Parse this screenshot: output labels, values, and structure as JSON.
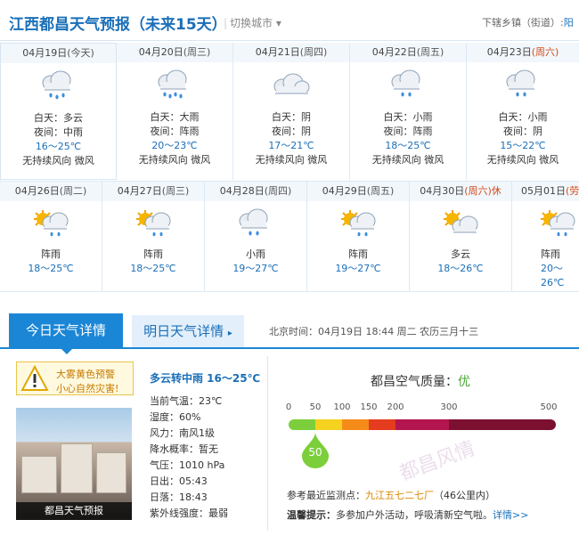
{
  "header": {
    "title": "江西都昌天气预报（未来15天）",
    "switch_city": "切换城市",
    "sub_town_label": "下辖乡镇（街道）:",
    "sub_town_value": "阳"
  },
  "forecast_row1": [
    {
      "date": "04月19日",
      "weekday": "(今天)",
      "day": "白天：多云",
      "night": "夜间：中雨",
      "temp": "16～25℃",
      "wind": "无持续风向  微风",
      "icon": "cloud-rain-icon"
    },
    {
      "date": "04月20日",
      "weekday": "(周三)",
      "day": "白天：大雨",
      "night": "夜间：阵雨",
      "temp": "20～23℃",
      "wind": "无持续风向  微风",
      "icon": "cloud-rain-icon"
    },
    {
      "date": "04月21日",
      "weekday": "(周四)",
      "day": "白天：阴",
      "night": "夜间：阴",
      "temp": "17～21℃",
      "wind": "无持续风向  微风",
      "icon": "cloud-icon"
    },
    {
      "date": "04月22日",
      "weekday": "(周五)",
      "day": "白天：小雨",
      "night": "夜间：阵雨",
      "temp": "18～25℃",
      "wind": "无持续风向  微风",
      "icon": "cloud-rain-icon"
    },
    {
      "date": "04月23日",
      "weekday": "(周六)",
      "day": "白天：小雨",
      "night": "夜间：阴",
      "temp": "15～22℃",
      "wind": "无持续风向  微风",
      "icon": "cloud-rain-icon"
    }
  ],
  "forecast_row2": [
    {
      "date": "04月26日",
      "weekday": "(周二)",
      "desc": "阵雨",
      "temp": "18～25℃",
      "icon": "sun-cloud-rain-icon"
    },
    {
      "date": "04月27日",
      "weekday": "(周三)",
      "desc": "阵雨",
      "temp": "18～25℃",
      "icon": "sun-cloud-rain-icon"
    },
    {
      "date": "04月28日",
      "weekday": "(周四)",
      "desc": "小雨",
      "temp": "19～27℃",
      "icon": "cloud-rain-icon"
    },
    {
      "date": "04月29日",
      "weekday": "(周五)",
      "desc": "阵雨",
      "temp": "19～27℃",
      "icon": "sun-cloud-rain-icon"
    },
    {
      "date": "04月30日",
      "weekday": "(周六)",
      "holiday": "休",
      "desc": "多云",
      "temp": "18～26℃",
      "icon": "sun-cloud-icon"
    },
    {
      "date": "05月01日",
      "weekday": "(劳动",
      "desc": "阵雨",
      "temp": "20～26℃",
      "icon": "sun-cloud-rain-icon"
    }
  ],
  "tabs": {
    "today": "今日天气详情",
    "tomorrow": "明日天气详情",
    "time_info": "北京时间：04月19日  18:44  周二    农历三月十三"
  },
  "warning": {
    "line1": "大雾黄色预警",
    "line2": "小心自然灾害!"
  },
  "photo_caption": "都昌天气预报",
  "today": {
    "condition": "多云转中雨  16～25℃",
    "details": [
      "当前气温：23℃",
      "湿度：60%",
      "风力：南风1级",
      "降水概率：暂无",
      "气压：1010 hPa",
      "日出：05:43",
      "日落：18:43",
      "紫外线强度：最弱"
    ]
  },
  "aqi": {
    "title_prefix": "都昌空气质量：",
    "level": "优",
    "value": "50",
    "value_num": 50,
    "scale_labels": [
      "0",
      "50",
      "100",
      "150",
      "200",
      "300",
      "500"
    ],
    "scale_values": [
      0,
      50,
      100,
      150,
      200,
      300,
      500
    ],
    "colors": [
      "#7ccf3a",
      "#f4d21f",
      "#f58c1a",
      "#e53b1e",
      "#b3154f",
      "#7c1030"
    ],
    "station_label": "参考最近监测点：",
    "station_name": "九江五七二七厂",
    "station_dist": "（46公里内）",
    "tip_label": "温馨提示：",
    "tip_text": "多参加户外活动，呼吸清新空气啦。",
    "tip_more": "详情>>"
  },
  "watermark": "都昌风情"
}
